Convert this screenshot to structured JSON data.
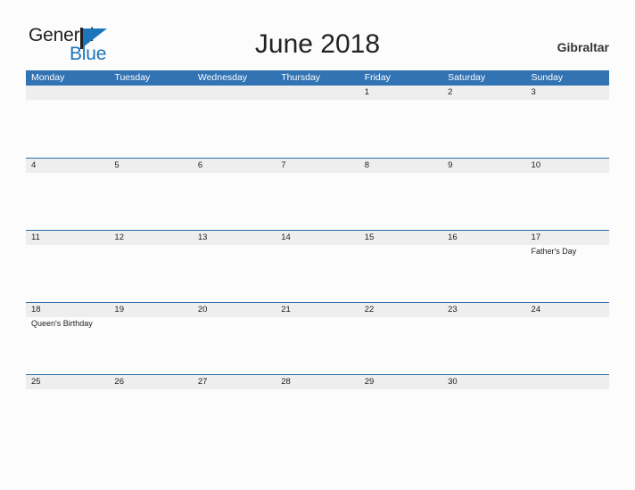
{
  "brand": {
    "name_part1": "General",
    "name_part2": "Blue",
    "mark": "triangle-logo-icon"
  },
  "header": {
    "title": "June 2018",
    "locale": "Gibraltar"
  },
  "calendar": {
    "weekdays": [
      "Monday",
      "Tuesday",
      "Wednesday",
      "Thursday",
      "Friday",
      "Saturday",
      "Sunday"
    ],
    "accent_color": "#3173b3",
    "band_color": "#eeeeee",
    "rule_color": "#2b6ca9",
    "weeks": [
      [
        {
          "day": "",
          "event": ""
        },
        {
          "day": "",
          "event": ""
        },
        {
          "day": "",
          "event": ""
        },
        {
          "day": "",
          "event": ""
        },
        {
          "day": "1",
          "event": ""
        },
        {
          "day": "2",
          "event": ""
        },
        {
          "day": "3",
          "event": ""
        }
      ],
      [
        {
          "day": "4",
          "event": ""
        },
        {
          "day": "5",
          "event": ""
        },
        {
          "day": "6",
          "event": ""
        },
        {
          "day": "7",
          "event": ""
        },
        {
          "day": "8",
          "event": ""
        },
        {
          "day": "9",
          "event": ""
        },
        {
          "day": "10",
          "event": ""
        }
      ],
      [
        {
          "day": "11",
          "event": ""
        },
        {
          "day": "12",
          "event": ""
        },
        {
          "day": "13",
          "event": ""
        },
        {
          "day": "14",
          "event": ""
        },
        {
          "day": "15",
          "event": ""
        },
        {
          "day": "16",
          "event": ""
        },
        {
          "day": "17",
          "event": "Father's Day"
        }
      ],
      [
        {
          "day": "18",
          "event": "Queen's Birthday"
        },
        {
          "day": "19",
          "event": ""
        },
        {
          "day": "20",
          "event": ""
        },
        {
          "day": "21",
          "event": ""
        },
        {
          "day": "22",
          "event": ""
        },
        {
          "day": "23",
          "event": ""
        },
        {
          "day": "24",
          "event": ""
        }
      ],
      [
        {
          "day": "25",
          "event": ""
        },
        {
          "day": "26",
          "event": ""
        },
        {
          "day": "27",
          "event": ""
        },
        {
          "day": "28",
          "event": ""
        },
        {
          "day": "29",
          "event": ""
        },
        {
          "day": "30",
          "event": ""
        },
        {
          "day": "",
          "event": ""
        }
      ]
    ]
  }
}
